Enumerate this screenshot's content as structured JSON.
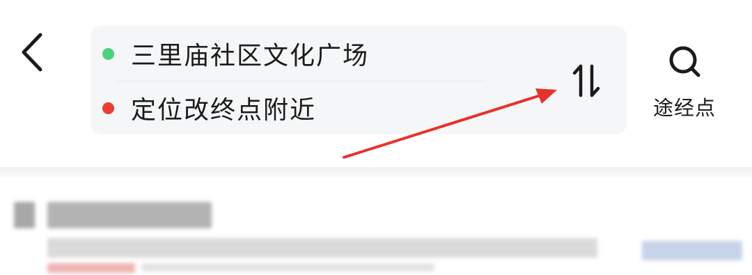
{
  "route": {
    "start": "三里庙社区文化广场",
    "end": "定位改终点附近"
  },
  "waypoint": {
    "label": "途经点"
  },
  "icons": {
    "back": "chevron-left-icon",
    "swap": "swap-vertical-icon",
    "search": "search-icon"
  },
  "colors": {
    "start_dot": "#4cd27a",
    "end_dot": "#ec3b35",
    "annotation_arrow": "#e8312b"
  }
}
